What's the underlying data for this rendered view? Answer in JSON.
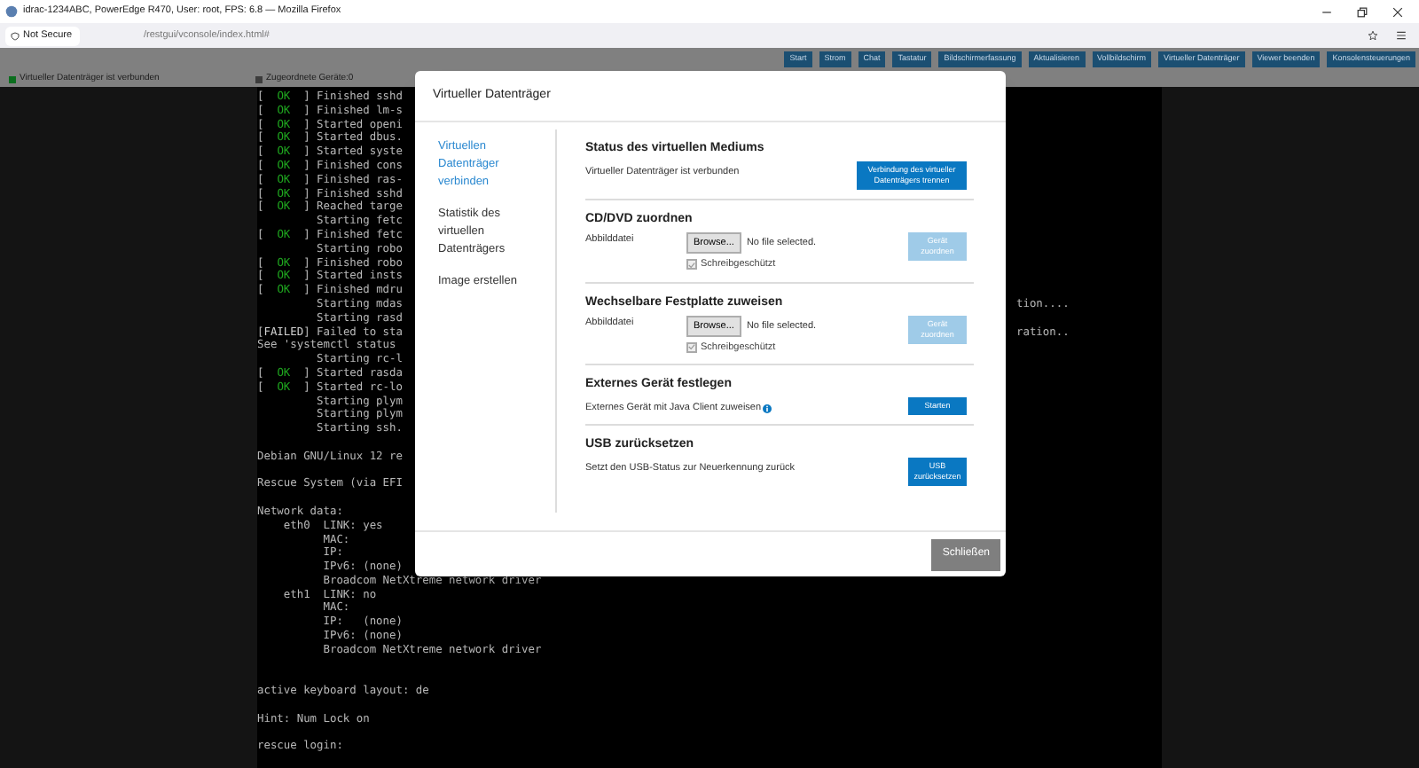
{
  "window": {
    "title": "idrac-1234ABC, PowerEdge R470, User: root, FPS: 6.8 — Mozilla Firefox"
  },
  "address_bar": {
    "security": "Not Secure",
    "url": "/restgui/vconsole/index.html#"
  },
  "toolbar": [
    "Start",
    "Strom",
    "Chat",
    "Tastatur",
    "Bildschirmerfassung",
    "Aktualisieren",
    "Vollbildschirm",
    "Virtueller Datenträger",
    "Viewer beenden",
    "Konsolensteuerungen"
  ],
  "status_line": [
    {
      "text": "Virtueller Datenträger ist verbunden",
      "color": "#0b6e1e"
    },
    {
      "text": "Zugeordnete Geräte:0",
      "color": "#3c3c3c"
    }
  ],
  "console": [
    {
      "kind": "ok",
      "open": "[  ",
      "tag": "OK",
      "text": "  ] Finished sshd"
    },
    {
      "kind": "ok",
      "open": "[  ",
      "tag": "OK",
      "text": "  ] Finished lm-s"
    },
    {
      "kind": "ok",
      "open": "[  ",
      "tag": "OK",
      "text": "  ] Started openi"
    },
    {
      "kind": "ok",
      "open": "[  ",
      "tag": "OK",
      "text": "  ] Started dbus."
    },
    {
      "kind": "ok",
      "open": "[  ",
      "tag": "OK",
      "text": "  ] Started syste"
    },
    {
      "kind": "ok",
      "open": "[  ",
      "tag": "OK",
      "text": "  ] Finished cons"
    },
    {
      "kind": "ok",
      "open": "[  ",
      "tag": "OK",
      "text": "  ] Finished ras-"
    },
    {
      "kind": "ok",
      "open": "[  ",
      "tag": "OK",
      "text": "  ] Finished sshd"
    },
    {
      "kind": "ok",
      "open": "[  ",
      "tag": "OK",
      "text": "  ] Reached targe"
    },
    {
      "kind": "plain",
      "text": "         Starting fetc"
    },
    {
      "kind": "ok",
      "open": "[  ",
      "tag": "OK",
      "text": "  ] Finished fetc"
    },
    {
      "kind": "plain",
      "text": "         Starting robo"
    },
    {
      "kind": "ok",
      "open": "[  ",
      "tag": "OK",
      "text": "  ] Finished robo"
    },
    {
      "kind": "ok",
      "open": "[  ",
      "tag": "OK",
      "text": "  ] Started insts"
    },
    {
      "kind": "ok",
      "open": "[  ",
      "tag": "OK",
      "text": "  ] Finished mdru"
    },
    {
      "kind": "plain",
      "text": "         Starting mdas",
      "tail": "tion...."
    },
    {
      "kind": "plain",
      "text": "         Starting rasd"
    },
    {
      "kind": "failed",
      "open": "[",
      "tag": "FAILED",
      "text": "] Failed to sta",
      "tail": "ration.."
    },
    {
      "kind": "plain",
      "text": "See 'systemctl status"
    },
    {
      "kind": "plain",
      "text": "         Starting rc-l"
    },
    {
      "kind": "ok",
      "open": "[  ",
      "tag": "OK",
      "text": "  ] Started rasda"
    },
    {
      "kind": "ok",
      "open": "[  ",
      "tag": "OK",
      "text": "  ] Started rc-lo"
    },
    {
      "kind": "plain",
      "text": "         Starting plym"
    },
    {
      "kind": "plain",
      "text": "         Starting plym"
    },
    {
      "kind": "plain",
      "text": "         Starting ssh."
    },
    {
      "kind": "blank"
    },
    {
      "kind": "plain",
      "text": "Debian GNU/Linux 12 re"
    },
    {
      "kind": "blank"
    },
    {
      "kind": "plain",
      "text": "Rescue System (via EFI"
    },
    {
      "kind": "blank"
    },
    {
      "kind": "plain",
      "text": "Network data:"
    },
    {
      "kind": "plain",
      "text": "    eth0  LINK: yes"
    },
    {
      "kind": "plain",
      "text": "          MAC:"
    },
    {
      "kind": "plain",
      "text": "          IP:"
    },
    {
      "kind": "plain",
      "text": "          IPv6: (none)"
    },
    {
      "kind": "plain",
      "text": "          Broadcom NetXtreme network driver"
    },
    {
      "kind": "plain",
      "text": "    eth1  LINK: no"
    },
    {
      "kind": "plain",
      "text": "          MAC:"
    },
    {
      "kind": "plain",
      "text": "          IP:   (none)"
    },
    {
      "kind": "plain",
      "text": "          IPv6: (none)"
    },
    {
      "kind": "plain",
      "text": "          Broadcom NetXtreme network driver"
    },
    {
      "kind": "blank"
    },
    {
      "kind": "blank"
    },
    {
      "kind": "plain",
      "text": "active keyboard layout: de"
    },
    {
      "kind": "blank"
    },
    {
      "kind": "plain",
      "text": "Hint: Num Lock on"
    },
    {
      "kind": "blank"
    },
    {
      "kind": "plain",
      "text": "rescue login:"
    }
  ],
  "dialog": {
    "title": "Virtueller Datenträger",
    "nav": [
      {
        "label": "Virtuellen Datenträger verbinden",
        "selected": true
      },
      {
        "label": "Statistik des virtuellen Datenträgers",
        "selected": false
      },
      {
        "label": "Image erstellen",
        "selected": false
      }
    ],
    "sections": [
      {
        "kind": "status",
        "heading": "Status des virtuellen Mediums",
        "text": "Virtueller Datenträger ist verbunden",
        "info": false,
        "button": {
          "label": "Verbindung des virtueller Datenträgers trennen",
          "disabled": false
        }
      },
      {
        "kind": "mapping",
        "heading": "CD/DVD zuordnen",
        "label": "Abbilddatei",
        "browse": "Browse...",
        "file": "No file selected.",
        "checkbox": {
          "label": "Schreibgeschützt",
          "checked": true
        },
        "button": {
          "label": "Gerät zuordnen",
          "disabled": true
        }
      },
      {
        "kind": "mapping",
        "heading": "Wechselbare Festplatte zuweisen",
        "label": "Abbilddatei",
        "browse": "Browse...",
        "file": "No file selected.",
        "checkbox": {
          "label": "Schreibgeschützt",
          "checked": true
        },
        "button": {
          "label": "Gerät zuordnen",
          "disabled": true
        }
      },
      {
        "kind": "action",
        "heading": "Externes Gerät festlegen",
        "text": "Externes Gerät mit Java Client zuweisen",
        "info": true,
        "button": {
          "label": "Starten",
          "disabled": false
        }
      },
      {
        "kind": "action",
        "heading": "USB zurücksetzen",
        "text": "Setzt den USB-Status zur Neuerkennung zurück",
        "info": false,
        "button": {
          "label": "USB zurücksetzen",
          "disabled": false
        }
      }
    ],
    "close_button": "Schließen"
  }
}
